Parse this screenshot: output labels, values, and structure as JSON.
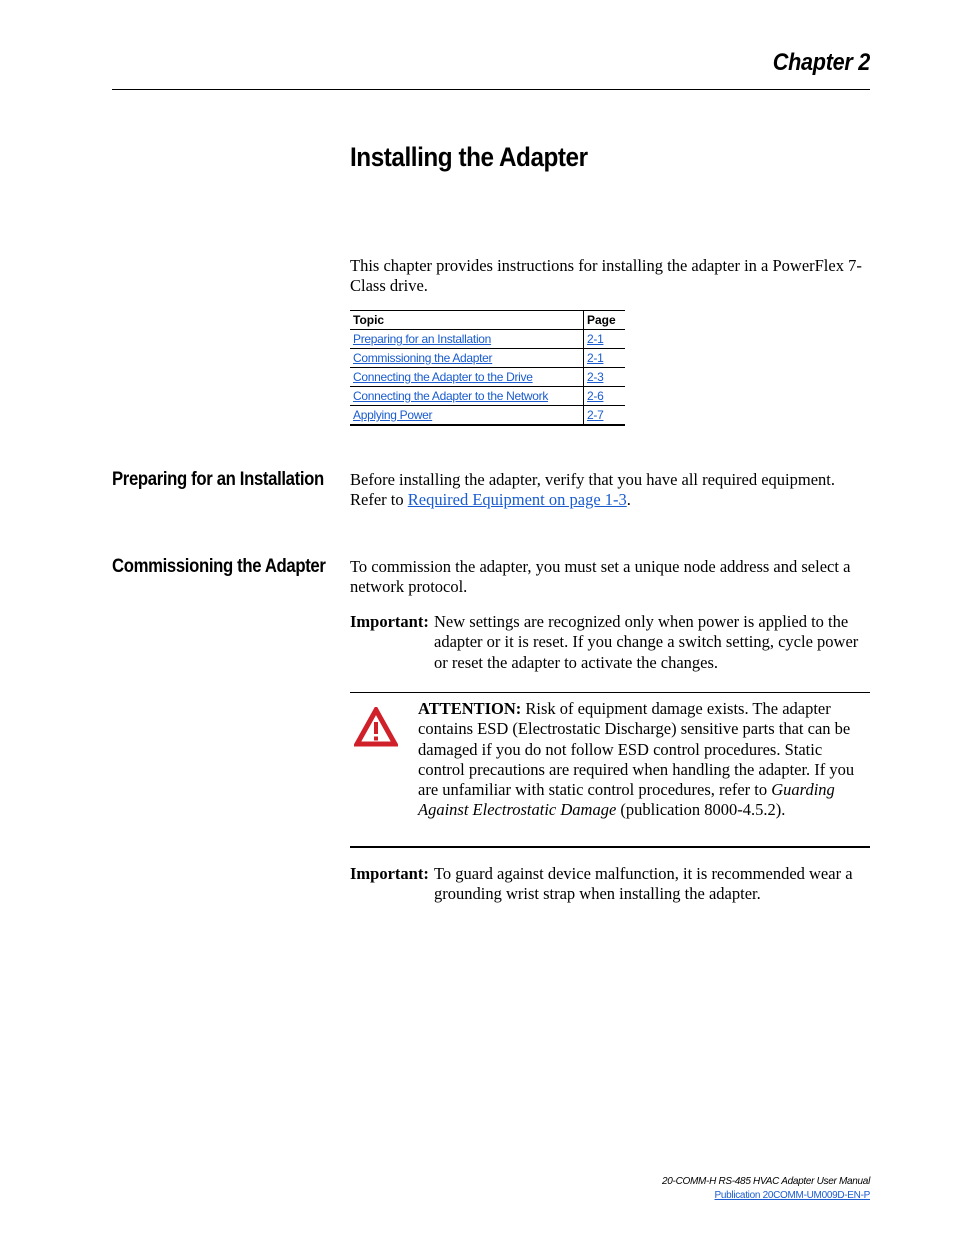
{
  "header": {
    "chapter_label": "Chapter 2"
  },
  "page_title": "Installing the Adapter",
  "intro": "This chapter provides instructions for installing the adapter in a PowerFlex 7-Class drive.",
  "toc": {
    "headers": {
      "topic": "Topic",
      "page": "Page"
    },
    "rows": [
      {
        "topic": "Preparing for an Installation",
        "page": "2-1"
      },
      {
        "topic": "Commissioning the Adapter",
        "page": "2-1"
      },
      {
        "topic": "Connecting the Adapter to the Drive",
        "page": "2-3"
      },
      {
        "topic": "Connecting the Adapter to the Network",
        "page": "2-6"
      },
      {
        "topic": "Applying Power",
        "page": "2-7"
      }
    ]
  },
  "sections": {
    "preparing": {
      "heading": "Preparing for an Installation",
      "text_before": "Before installing the adapter, verify that you have all required equipment. Refer to ",
      "link": "Required Equipment on page 1-3",
      "text_after": "."
    },
    "commissioning": {
      "heading": "Commissioning the Adapter",
      "text": "To commission the adapter, you must set a unique node address and select a network protocol.",
      "important_1": {
        "label": "Important:",
        "text": "New settings are recognized only when power is applied to the adapter or it is reset. If you change a switch setting, cycle power or reset the adapter to activate the changes."
      },
      "attention": {
        "icon": "warning-triangle-icon",
        "icon_color": "#d0202a",
        "label": "ATTENTION:",
        "text": " Risk of equipment damage exists. The adapter contains ESD (Electrostatic Discharge) sensitive parts that can be damaged if you do not follow ESD control procedures. Static control precautions are required when handling the adapter. If you are unfamiliar with static control procedures, refer to ",
        "ref_title": "Guarding Against Electrostatic Damage",
        "ref_suffix": " (publication 8000-4.5.2)."
      },
      "important_2": {
        "label": "Important:",
        "text": "To guard against device malfunction, it is recommended wear a grounding wrist strap when installing the adapter."
      }
    }
  },
  "footer": {
    "manual_title": "20-COMM-H RS-485 HVAC Adapter User Manual",
    "publication_link": "Publication 20COMM-UM009D-EN-P"
  },
  "colors": {
    "link": "#1a5ccf",
    "warning": "#d0202a"
  }
}
